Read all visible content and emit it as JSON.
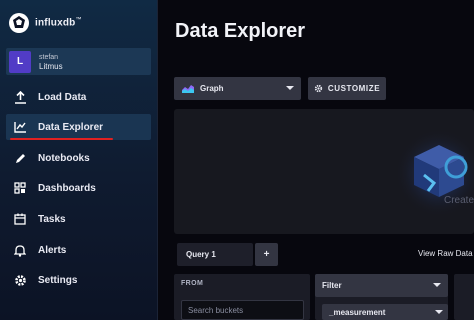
{
  "sidebar": {
    "brand": "influxdb",
    "brand_tm": "™",
    "user": {
      "initial": "L",
      "name": "stefan",
      "org": "Litmus"
    },
    "items": [
      {
        "label": "Load Data",
        "icon": "upload-icon",
        "active": false
      },
      {
        "label": "Data Explorer",
        "icon": "graph-line-icon",
        "active": true
      },
      {
        "label": "Notebooks",
        "icon": "pencil-icon",
        "active": false
      },
      {
        "label": "Dashboards",
        "icon": "dashboards-grid-icon",
        "active": false
      },
      {
        "label": "Tasks",
        "icon": "calendar-icon",
        "active": false
      },
      {
        "label": "Alerts",
        "icon": "bell-icon",
        "active": false
      },
      {
        "label": "Settings",
        "icon": "gear-icon",
        "active": false
      }
    ]
  },
  "main": {
    "title": "Data Explorer",
    "graph_type": "Graph",
    "customize_label": "CUSTOMIZE",
    "graph_area_text": "Create a",
    "query_tab": "Query 1",
    "add_query": "+",
    "view_raw_label": "View Raw Data",
    "from_label": "FROM",
    "search_placeholder": "Search buckets",
    "filter_label": "Filter",
    "measurement_label": "_measurement"
  },
  "colors": {
    "sidebar_bg": "#102a44",
    "active_underline": "#e02121",
    "avatar": "#513cc6",
    "button_bg": "#333542",
    "page_bg": "#07070e"
  }
}
